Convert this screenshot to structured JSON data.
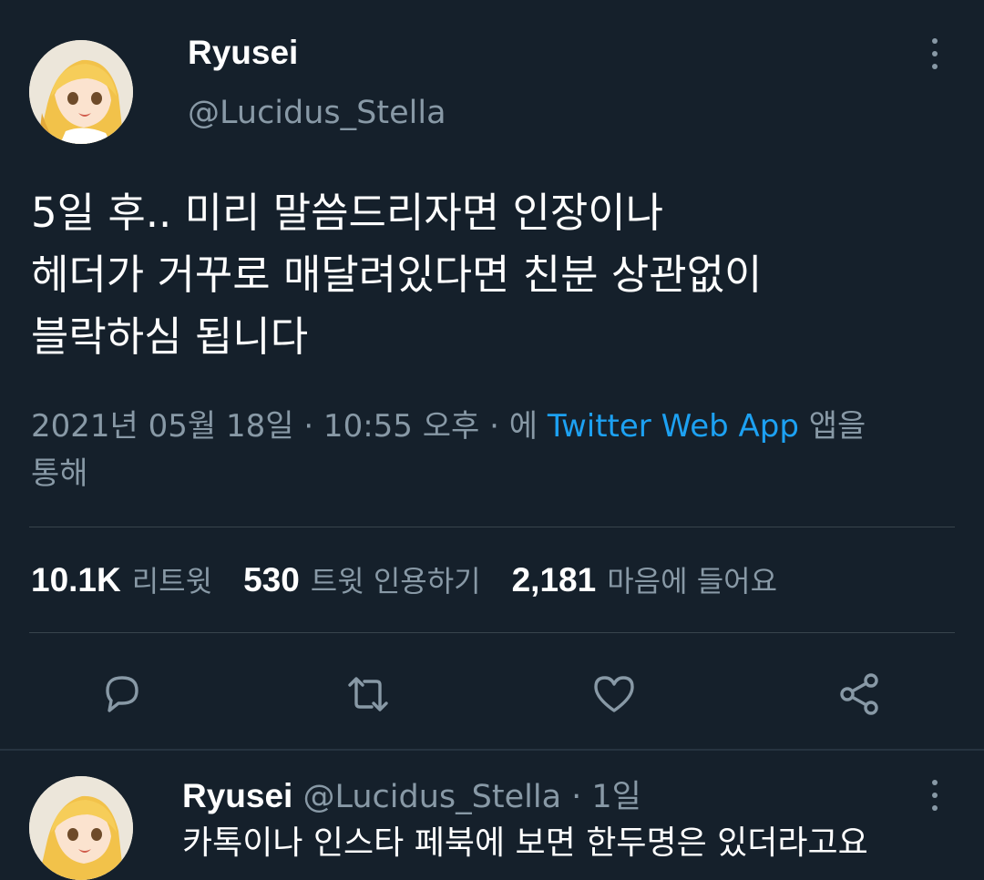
{
  "tweet": {
    "display_name": "Ryusei",
    "handle": "@Lucidus_Stella",
    "text_lines": [
      "5일 후.. 미리 말씀드리자면 인장이나",
      "헤더가 거꾸로 매달려있다면 친분 상관없이",
      "블락하심 됩니다"
    ],
    "timestamp": "2021년 05월 18일 · 10:55 오후 · 에",
    "source": "Twitter Web App",
    "source_suffix_1": "앱을",
    "source_suffix_2": "통해",
    "stats": {
      "retweets_count": "10.1K",
      "retweets_label": "리트윗",
      "quotes_count": "530",
      "quotes_label": "트윗 인용하기",
      "likes_count": "2,181",
      "likes_label": "마음에 들어요"
    }
  },
  "actions": {
    "reply_icon": "speech-bubble-icon",
    "retweet_icon": "retweet-arrows-icon",
    "like_icon": "heart-icon",
    "share_icon": "share-nodes-icon"
  },
  "reply": {
    "display_name": "Ryusei",
    "handle_time": "@Lucidus_Stella · 1일",
    "text": "카톡이나 인스타 페북에 보면 한두명은 있더라고요"
  },
  "colors": {
    "background": "#15202b",
    "secondary_text": "#8899a6",
    "link": "#1da1f2",
    "divider": "#38444d"
  }
}
